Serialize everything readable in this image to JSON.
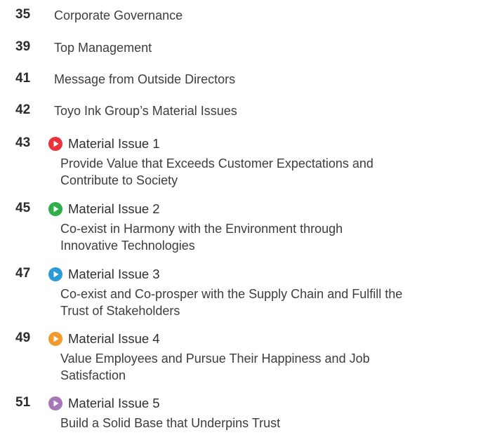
{
  "entries": [
    {
      "page": "35",
      "title": "Corporate Governance"
    },
    {
      "page": "39",
      "title": "Top Management"
    },
    {
      "page": "41",
      "title": "Message from Outside Directors"
    },
    {
      "page": "42",
      "title": "Toyo Ink Group’s Material Issues"
    }
  ],
  "material_issues": [
    {
      "page": "43",
      "heading": "Material Issue 1",
      "desc_line1": "Provide Value that Exceeds Customer Expectations and",
      "desc_line2": "Contribute to Society",
      "color": "#e8343a"
    },
    {
      "page": "45",
      "heading": "Material Issue 2",
      "desc_line1": "Co-exist in Harmony with the Environment through",
      "desc_line2": "Innovative Technologies",
      "color": "#2fae4a"
    },
    {
      "page": "47",
      "heading": "Material Issue 3",
      "desc_line1": "Co-exist and Co-prosper with the Supply Chain and Fulfill the",
      "desc_line2": "Trust of Stakeholders",
      "color": "#2c9ad6"
    },
    {
      "page": "49",
      "heading": "Material Issue 4",
      "desc_line1": "Value Employees and Pursue Their Happiness and Job",
      "desc_line2": "Satisfaction",
      "color": "#f29a2e"
    },
    {
      "page": "51",
      "heading": "Material Issue 5",
      "desc_line1": "Build a Solid Base that Underpins Trust",
      "desc_line2": "",
      "color": "#a678b8"
    }
  ]
}
